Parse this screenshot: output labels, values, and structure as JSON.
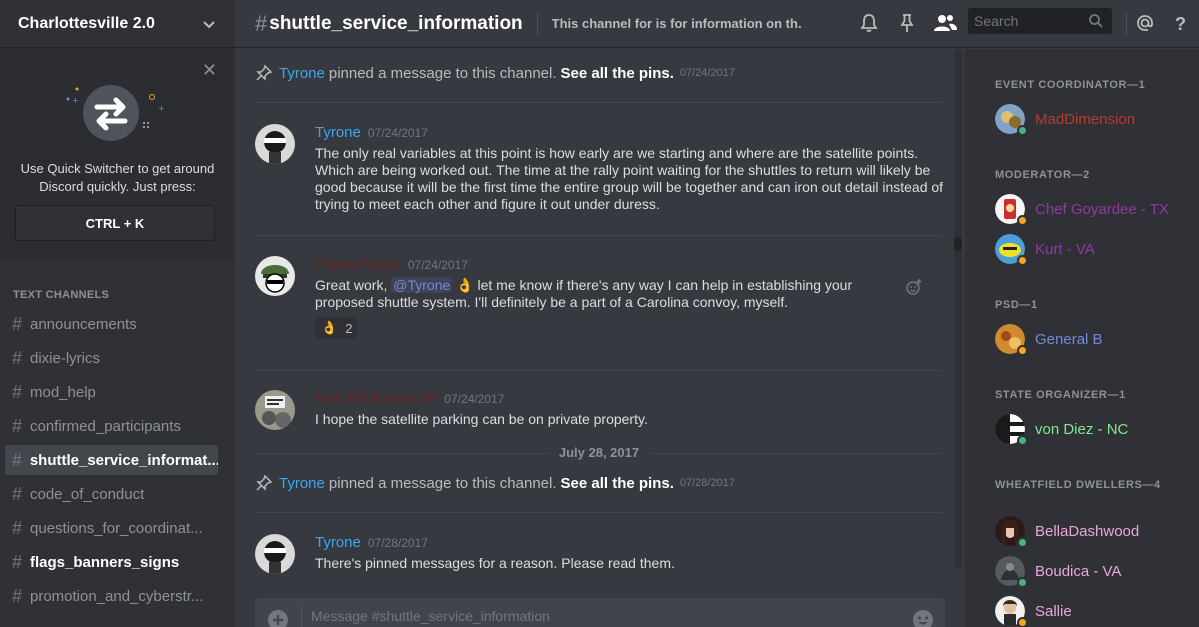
{
  "server": {
    "name": "Charlottesville 2.0"
  },
  "quick_switcher": {
    "text": "Use Quick Switcher to get around Discord quickly. Just press:",
    "shortcut": "CTRL + K"
  },
  "channels": {
    "category": "TEXT CHANNELS",
    "items": [
      {
        "name": "announcements",
        "state": "normal"
      },
      {
        "name": "dixie-lyrics",
        "state": "normal"
      },
      {
        "name": "mod_help",
        "state": "normal"
      },
      {
        "name": "confirmed_participants",
        "state": "normal"
      },
      {
        "name": "shuttle_service_informat...",
        "state": "active"
      },
      {
        "name": "code_of_conduct",
        "state": "normal"
      },
      {
        "name": "questions_for_coordinat...",
        "state": "normal"
      },
      {
        "name": "flags_banners_signs",
        "state": "unread"
      },
      {
        "name": "promotion_and_cyberstr...",
        "state": "normal"
      }
    ]
  },
  "header": {
    "channel": "shuttle_service_information",
    "topic": "This channel for is for information on th...",
    "search_placeholder": "Search"
  },
  "messages": {
    "pin1": {
      "user": "Tyrone",
      "text": "pinned a message to this channel.",
      "link": "See all the pins.",
      "ts": "07/24/2017"
    },
    "m1": {
      "author": "Tyrone",
      "author_color": "#3ea7e9",
      "ts": "07/24/2017",
      "text": "The only real variables at this point is how early are we starting and where are the satellite points. Which are being worked out. The time at the rally point waiting for the shuttles to return will likely be good because it will be the first time the entire group will be together and can iron out detail instead of trying to meet each other and figure it out under duress."
    },
    "m2": {
      "author": "FashyPolack",
      "author_color": "#6b2424",
      "ts": "07/24/2017",
      "pre": "Great work,",
      "mention": "@Tyrone",
      "emoji": "👌",
      "post": "let me know if there's any way I can help in establishing your proposed shuttle system. I'll definitely be a part of a Carolina convoy, myself.",
      "reaction_emoji": "👌",
      "reaction_count": "2"
    },
    "m3": {
      "author": "Red Pill Nation VA",
      "author_color": "#6b2424",
      "ts": "07/24/2017",
      "text": "I hope the satellite parking can be on private property."
    },
    "date_divider": "July 28, 2017",
    "pin2": {
      "user": "Tyrone",
      "text": "pinned a message to this channel.",
      "link": "See all the pins.",
      "ts": "07/28/2017"
    },
    "m4": {
      "author": "Tyrone",
      "author_color": "#3ea7e9",
      "ts": "07/28/2017",
      "text": "There's pinned messages for a reason. Please read them."
    }
  },
  "composer": {
    "placeholder": "Message #shuttle_service_information"
  },
  "members": {
    "groups": [
      {
        "role": "EVENT COORDINATOR—1",
        "members": [
          {
            "name": "MadDimension",
            "color": "#b83a2e",
            "status": "#43b581"
          }
        ]
      },
      {
        "role": "MODERATOR—2",
        "members": [
          {
            "name": "Chef Goyardee - TX",
            "color": "#8e3aa0",
            "status": "#faa61a"
          },
          {
            "name": "Kurt - VA",
            "color": "#8e3aa0",
            "status": "#faa61a"
          }
        ]
      },
      {
        "role": "PSD—1",
        "members": [
          {
            "name": "General B",
            "color": "#7289da",
            "status": "#faa61a"
          }
        ]
      },
      {
        "role": "STATE ORGANIZER—1",
        "members": [
          {
            "name": "von Diez - NC",
            "color": "#7fe88a",
            "status": "#43b581"
          }
        ]
      },
      {
        "role": "WHEATFIELD DWELLERS—4",
        "members": [
          {
            "name": "BellaDashwood",
            "color": "#e8a8d8",
            "status": "#43b581"
          },
          {
            "name": "Boudica - VA",
            "color": "#e8a8d8",
            "status": "#43b581"
          },
          {
            "name": "Sallie",
            "color": "#e8a8d8",
            "status": "#faa61a"
          }
        ]
      }
    ]
  }
}
